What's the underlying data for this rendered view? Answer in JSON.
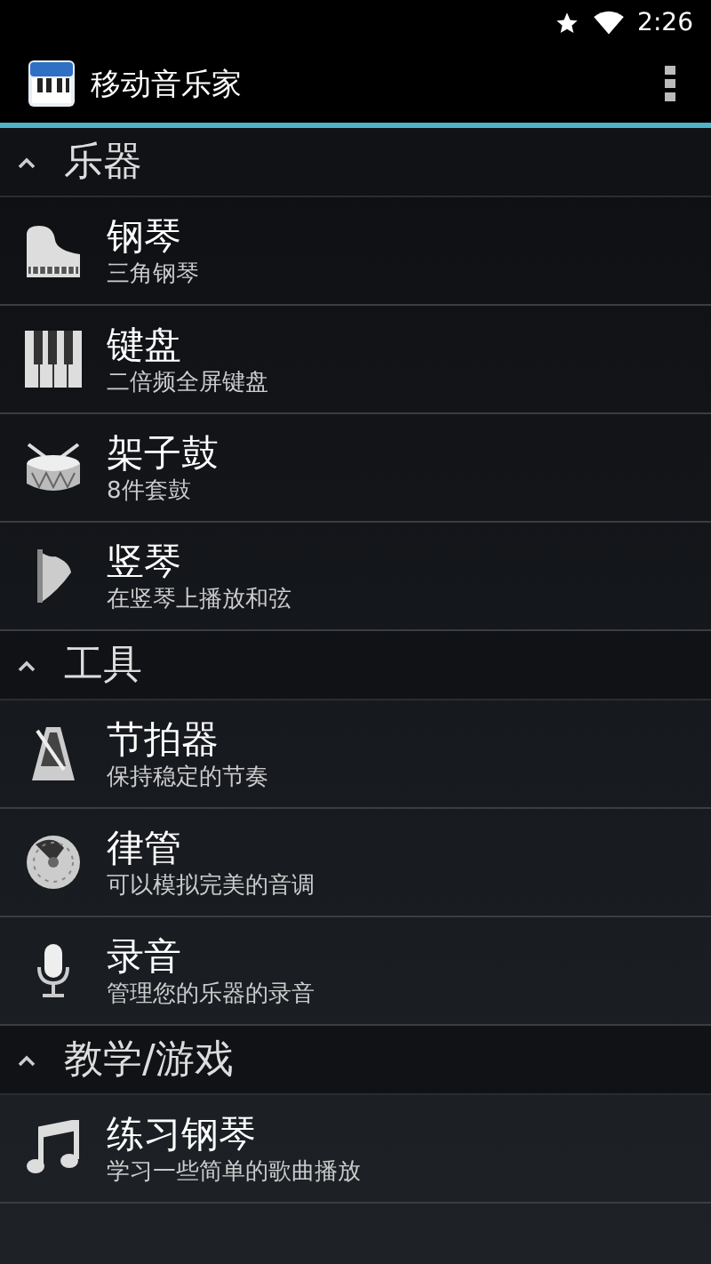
{
  "status_bar": {
    "time": "2:26"
  },
  "app_bar": {
    "title": "移动音乐家"
  },
  "sections": [
    {
      "title": "乐器",
      "expanded": true,
      "items": [
        {
          "kind": "piano",
          "title": "钢琴",
          "subtitle": "三角钢琴"
        },
        {
          "kind": "keyboard",
          "title": "键盘",
          "subtitle": "二倍频全屏键盘"
        },
        {
          "kind": "drum",
          "title": "架子鼓",
          "subtitle": "8件套鼓"
        },
        {
          "kind": "harp",
          "title": "竖琴",
          "subtitle": "在竖琴上播放和弦"
        }
      ]
    },
    {
      "title": "工具",
      "expanded": true,
      "items": [
        {
          "kind": "metronome",
          "title": "节拍器",
          "subtitle": "保持稳定的节奏"
        },
        {
          "kind": "pitchpipe",
          "title": "律管",
          "subtitle": "可以模拟完美的音调"
        },
        {
          "kind": "microphone",
          "title": "录音",
          "subtitle": "管理您的乐器的录音"
        }
      ]
    },
    {
      "title": "教学/游戏",
      "expanded": true,
      "items": [
        {
          "kind": "note",
          "title": "练习钢琴",
          "subtitle": "学习一些简单的歌曲播放"
        }
      ]
    }
  ]
}
